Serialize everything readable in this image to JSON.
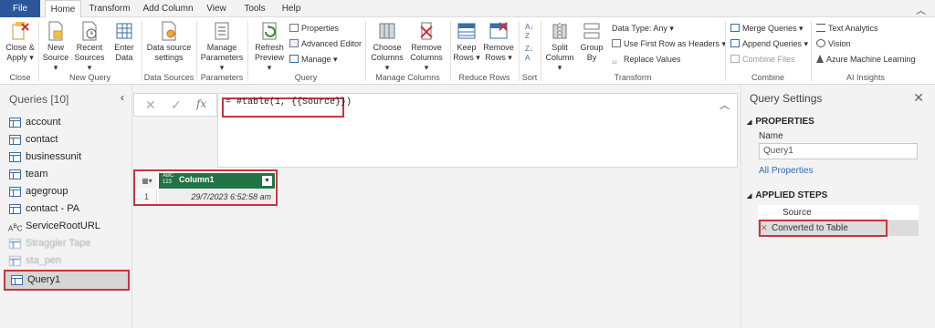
{
  "tabs": [
    "File",
    "Home",
    "Transform",
    "Add Column",
    "View",
    "Tools",
    "Help"
  ],
  "active_tab": "Home",
  "ribbon": {
    "close_apply": [
      "Close &",
      "Apply ▾"
    ],
    "new_source": [
      "New",
      "Source ▾"
    ],
    "recent_sources": [
      "Recent",
      "Sources ▾"
    ],
    "enter_data": [
      "Enter",
      "Data"
    ],
    "data_source_settings": [
      "Data source",
      "settings"
    ],
    "manage_parameters": [
      "Manage",
      "Parameters ▾"
    ],
    "refresh_preview": [
      "Refresh",
      "Preview ▾"
    ],
    "properties": "Properties",
    "advanced_editor": "Advanced Editor",
    "manage": "Manage ▾",
    "choose_columns": [
      "Choose",
      "Columns ▾"
    ],
    "remove_columns": [
      "Remove",
      "Columns ▾"
    ],
    "keep_rows": [
      "Keep",
      "Rows ▾"
    ],
    "remove_rows": [
      "Remove",
      "Rows ▾"
    ],
    "split_column": [
      "Split",
      "Column ▾"
    ],
    "group_by": [
      "Group",
      "By"
    ],
    "data_type": "Data Type: Any ▾",
    "first_row_headers": "Use First Row as Headers ▾",
    "replace_values": "Replace Values",
    "merge_queries": "Merge Queries ▾",
    "append_queries": "Append Queries ▾",
    "combine_files": "Combine Files",
    "text_analytics": "Text Analytics",
    "vision": "Vision",
    "azure_ml": "Azure Machine Learning",
    "groups": {
      "close": "Close",
      "new_query": "New Query",
      "data_sources": "Data Sources",
      "parameters": "Parameters",
      "query": "Query",
      "manage_columns": "Manage Columns",
      "reduce_rows": "Reduce Rows",
      "sort": "Sort",
      "transform": "Transform",
      "combine": "Combine",
      "ai_insights": "AI Insights"
    }
  },
  "queries": {
    "header": "Queries [10]",
    "items": [
      {
        "label": "account",
        "type": "table"
      },
      {
        "label": "contact",
        "type": "table"
      },
      {
        "label": "businessunit",
        "type": "table"
      },
      {
        "label": "team",
        "type": "table"
      },
      {
        "label": "agegroup",
        "type": "table"
      },
      {
        "label": "contact - PA",
        "type": "table"
      },
      {
        "label": "ServiceRootURL",
        "type": "text"
      },
      {
        "label": "Straggler Tape",
        "type": "table"
      },
      {
        "label": "sta_pen",
        "type": "table"
      },
      {
        "label": "Query1",
        "type": "table"
      }
    ]
  },
  "formula": {
    "text": "= #table(1, {{Source}})",
    "fx": "fx"
  },
  "grid": {
    "type_label": [
      "ABC",
      "123"
    ],
    "column": "Column1",
    "row_number": "1",
    "cell": "29/7/2023 6:52:58 am"
  },
  "settings": {
    "title": "Query Settings",
    "properties_header": "PROPERTIES",
    "name_label": "Name",
    "name_value": "Query1",
    "all_properties": "All Properties",
    "applied_steps_header": "APPLIED STEPS",
    "steps": [
      "Source",
      "Converted to Table"
    ]
  },
  "colors": {
    "file_tab": "#2b579a",
    "highlight": "#c9343b",
    "column_header": "#217346",
    "link": "#2b6cb0"
  }
}
